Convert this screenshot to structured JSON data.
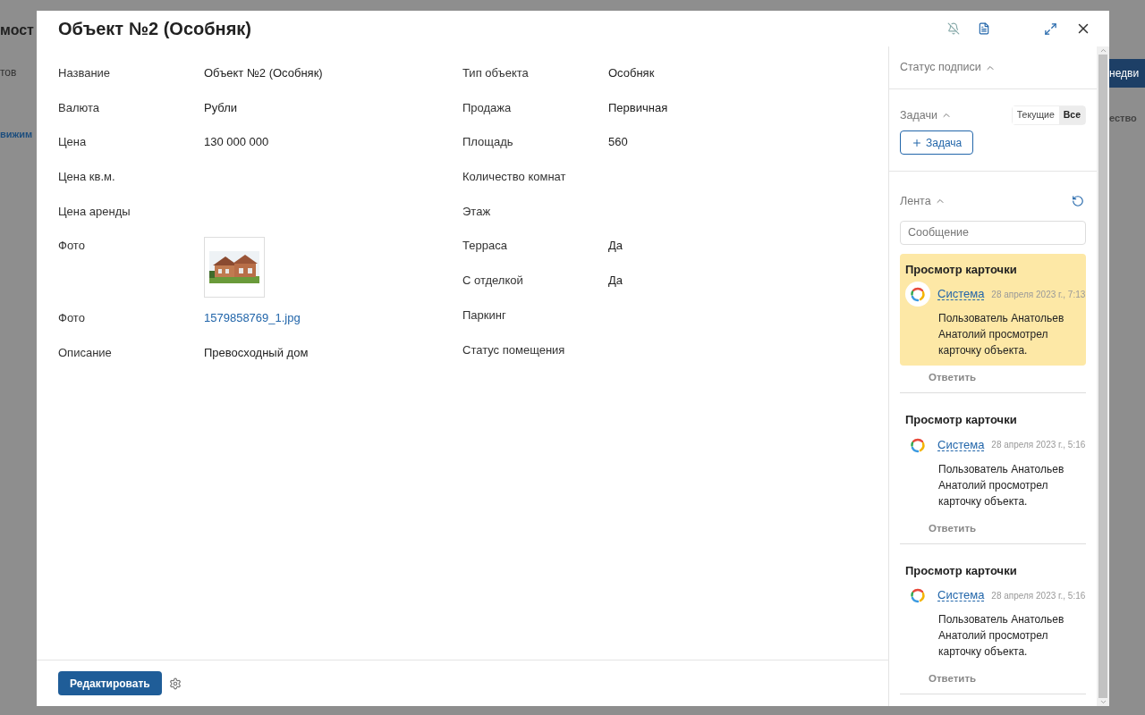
{
  "background": {
    "left_texts": [
      {
        "text": "мост",
        "kind": "heading"
      },
      {
        "text": "тов",
        "kind": "plain"
      },
      {
        "text": "вижим",
        "kind": "link"
      }
    ],
    "right_button": "недви",
    "right_text": "ество"
  },
  "modal": {
    "title": "Объект №2 (Особняк)",
    "columns": [
      [
        {
          "label": "Название",
          "kind": "text",
          "value": "Объект №2 (Особняк)"
        },
        {
          "label": "Валюта",
          "kind": "text",
          "value": "Рубли"
        },
        {
          "label": "Цена",
          "kind": "text",
          "value": "130 000 000"
        },
        {
          "label": "Цена кв.м.",
          "kind": "text"
        },
        {
          "label": "Цена аренды",
          "kind": "text"
        },
        {
          "label": "Фото"
        },
        {
          "label": "Фото",
          "kind": "link",
          "value": "1579858769_1.jpg"
        },
        {
          "label": "Описание",
          "kind": "text",
          "value": "Превосходный дом"
        }
      ],
      [
        {
          "label": "Тип объекта",
          "kind": "text",
          "value": "Особняк"
        },
        {
          "label": "Продажа",
          "kind": "text",
          "value": "Первичная"
        },
        {
          "label": "Площадь",
          "kind": "text",
          "value": "560"
        },
        {
          "label": "Количество комнат",
          "kind": "text"
        },
        {
          "label": "Этаж",
          "kind": "text"
        },
        {
          "label": "Терраса",
          "kind": "text",
          "value": "Да"
        },
        {
          "label": "С отделкой",
          "kind": "text",
          "value": "Да"
        },
        {
          "label": "Паркинг",
          "kind": "text"
        },
        {
          "label": "Статус помещения",
          "kind": "text"
        }
      ]
    ],
    "edit_button": "Редактировать",
    "side": {
      "signature_status": "Статус подписи",
      "tasks": {
        "label": "Задачи",
        "filters": [
          {
            "label": "Текущие",
            "selected": false
          },
          {
            "label": "Все",
            "selected": true
          }
        ],
        "add_button": "Задача"
      },
      "feed": {
        "label": "Лента",
        "placeholder": "Сообщение",
        "entries": [
          {
            "title": "Просмотр карточки",
            "author": "Система",
            "time": "28 апреля 2023 г., 7:13",
            "text": "Пользователь Анатольев Анатолий просмотрел карточку объекта.",
            "reply": "Ответить",
            "highlighted": true
          },
          {
            "title": "Просмотр карточки",
            "author": "Система",
            "time": "28 апреля 2023 г., 5:16",
            "text": "Пользователь Анатольев Анатолий просмотрел карточку объекта.",
            "reply": "Ответить",
            "highlighted": false
          },
          {
            "title": "Просмотр карточки",
            "author": "Система",
            "time": "28 апреля 2023 г., 5:16",
            "text": "Пользователь Анатольев Анатолий просмотрел карточку объекта.",
            "reply": "Ответить",
            "highlighted": false
          }
        ]
      }
    }
  }
}
